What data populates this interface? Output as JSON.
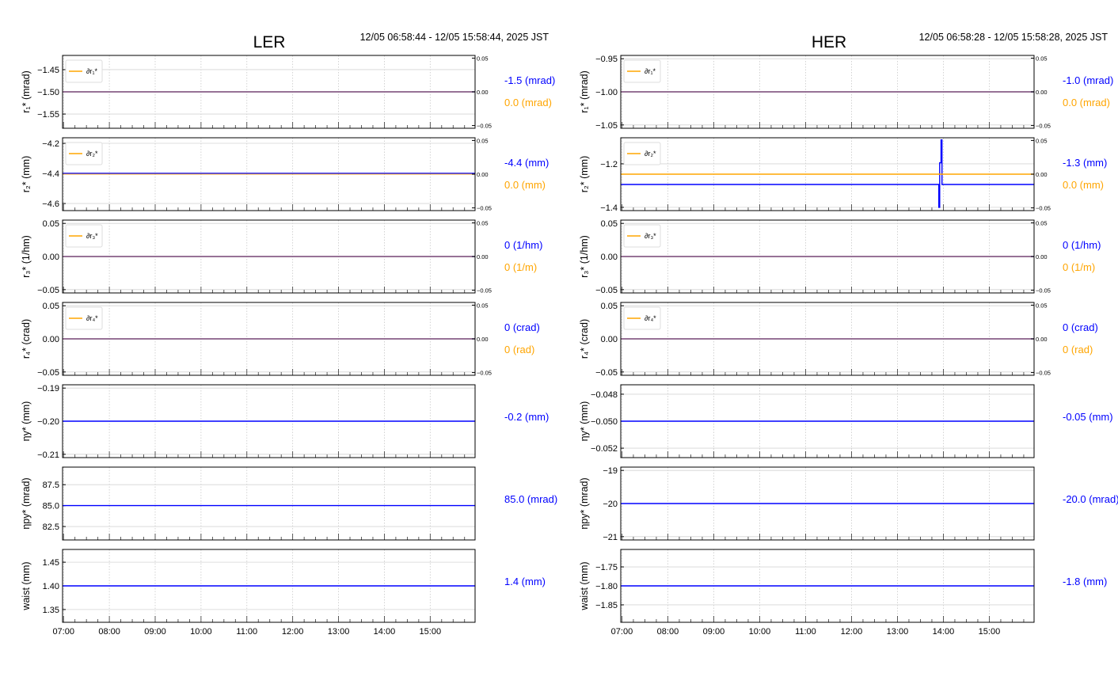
{
  "colors": {
    "blue": "#0000ff",
    "orange": "#ffa500",
    "grid": "#d0d0d0",
    "axis": "#000000"
  },
  "chart_data": [
    {
      "type": "line",
      "title": "LER",
      "time_range": "12/05 06:58:44 - 12/05 15:58:44, 2025 JST",
      "xlim": [
        6.979,
        15.979
      ],
      "x_ticks": [
        7,
        8,
        9,
        10,
        11,
        12,
        13,
        14,
        15
      ],
      "x_tick_labels": [
        "07:00",
        "08:00",
        "09:00",
        "10:00",
        "11:00",
        "12:00",
        "13:00",
        "14:00",
        "15:00"
      ],
      "panels": [
        {
          "ylabel": "r₁* (mrad)",
          "ylim": [
            -1.582,
            -1.418
          ],
          "yticks": [
            -1.45,
            -1.5,
            -1.55
          ],
          "ytick_labels": [
            "−1.45",
            "−1.50",
            "−1.55"
          ],
          "series": [
            {
              "name": "r1*",
              "color": "#0000ff",
              "axis": "left",
              "points": [
                [
                  6.979,
                  -1.5
                ],
                [
                  15.979,
                  -1.5
                ]
              ]
            },
            {
              "name": "∂r1*",
              "color": "#ffa500",
              "axis": "right",
              "points": [
                [
                  6.979,
                  0
                ],
                [
                  15.979,
                  0
                ]
              ]
            }
          ],
          "right": {
            "ylim": [
              -0.054,
              0.054
            ],
            "yticks": [
              0.05,
              0.0,
              -0.05
            ],
            "ytick_labels": [
              "0.05",
              "0.00",
              "−0.05"
            ]
          },
          "legend": "∂r₁*",
          "readouts": [
            {
              "text": "-1.5 (mrad)",
              "color": "#0000ff"
            },
            {
              "text": "0.0 (mrad)",
              "color": "#ffa500"
            }
          ]
        },
        {
          "ylabel": "r₂* (mm)",
          "ylim": [
            -4.647,
            -4.163
          ],
          "yticks": [
            -4.2,
            -4.4,
            -4.6
          ],
          "ytick_labels": [
            "−4.2",
            "−4.4",
            "−4.6"
          ],
          "series": [
            {
              "name": "r2*",
              "color": "#0000ff",
              "axis": "left",
              "points": [
                [
                  6.979,
                  -4.4
                ],
                [
                  15.979,
                  -4.4
                ]
              ]
            },
            {
              "name": "∂r2*",
              "color": "#ffa500",
              "axis": "right",
              "points": [
                [
                  6.979,
                  0
                ],
                [
                  15.979,
                  0
                ]
              ]
            }
          ],
          "right": {
            "ylim": [
              -0.054,
              0.054
            ],
            "yticks": [
              0.05,
              0.0,
              -0.05
            ],
            "ytick_labels": [
              "0.05",
              "0.00",
              "−0.05"
            ]
          },
          "legend": "∂r₂*",
          "readouts": [
            {
              "text": "-4.4 (mm)",
              "color": "#0000ff"
            },
            {
              "text": "0.0 (mm)",
              "color": "#ffa500"
            }
          ]
        },
        {
          "ylabel": "r₃* (1/hm)",
          "ylim": [
            -0.055,
            0.055
          ],
          "yticks": [
            0.05,
            0.0,
            -0.05
          ],
          "ytick_labels": [
            "0.05",
            "0.00",
            "−0.05"
          ],
          "series": [
            {
              "name": "r3*",
              "color": "#0000ff",
              "axis": "left",
              "points": [
                [
                  6.979,
                  0
                ],
                [
                  15.979,
                  0
                ]
              ]
            },
            {
              "name": "∂r3*",
              "color": "#ffa500",
              "axis": "right",
              "points": [
                [
                  6.979,
                  0
                ],
                [
                  15.979,
                  0
                ]
              ]
            }
          ],
          "right": {
            "ylim": [
              -0.054,
              0.054
            ],
            "yticks": [
              0.05,
              0.0,
              -0.05
            ],
            "ytick_labels": [
              "0.05",
              "0.00",
              "−0.05"
            ]
          },
          "legend": "∂r₃*",
          "readouts": [
            {
              "text": "0 (1/hm)",
              "color": "#0000ff"
            },
            {
              "text": "0 (1/m)",
              "color": "#ffa500"
            }
          ]
        },
        {
          "ylabel": "r₄* (crad)",
          "ylim": [
            -0.055,
            0.055
          ],
          "yticks": [
            0.05,
            0.0,
            -0.05
          ],
          "ytick_labels": [
            "0.05",
            "0.00",
            "−0.05"
          ],
          "series": [
            {
              "name": "r4*",
              "color": "#0000ff",
              "axis": "left",
              "points": [
                [
                  6.979,
                  0
                ],
                [
                  15.979,
                  0
                ]
              ]
            },
            {
              "name": "∂r4*",
              "color": "#ffa500",
              "axis": "right",
              "points": [
                [
                  6.979,
                  0
                ],
                [
                  15.979,
                  0
                ]
              ]
            }
          ],
          "right": {
            "ylim": [
              -0.054,
              0.054
            ],
            "yticks": [
              0.05,
              0.0,
              -0.05
            ],
            "ytick_labels": [
              "0.05",
              "0.00",
              "−0.05"
            ]
          },
          "legend": "∂r₄*",
          "readouts": [
            {
              "text": "0 (crad)",
              "color": "#0000ff"
            },
            {
              "text": "0 (rad)",
              "color": "#ffa500"
            }
          ]
        },
        {
          "ylabel": "ηy* (mm)",
          "ylim": [
            -0.211,
            -0.189
          ],
          "yticks": [
            -0.19,
            -0.2,
            -0.21
          ],
          "ytick_labels": [
            "−0.19",
            "−0.20",
            "−0.21"
          ],
          "series": [
            {
              "name": "eta_y*",
              "color": "#0000ff",
              "axis": "left",
              "points": [
                [
                  6.979,
                  -0.2
                ],
                [
                  15.979,
                  -0.2
                ]
              ]
            }
          ],
          "readouts": [
            {
              "text": "-0.2 (mm)",
              "color": "#0000ff"
            }
          ]
        },
        {
          "ylabel": "ηpy* (mrad)",
          "ylim": [
            80.9,
            89.6
          ],
          "yticks": [
            87.5,
            85.0,
            82.5
          ],
          "ytick_labels": [
            "87.5",
            "85.0",
            "82.5"
          ],
          "series": [
            {
              "name": "eta_py*",
              "color": "#0000ff",
              "axis": "left",
              "points": [
                [
                  6.979,
                  85.0
                ],
                [
                  15.979,
                  85.0
                ]
              ]
            }
          ],
          "readouts": [
            {
              "text": "85.0 (mrad)",
              "color": "#0000ff"
            }
          ]
        },
        {
          "ylabel": "waist (mm)",
          "ylim": [
            1.323,
            1.477
          ],
          "yticks": [
            1.45,
            1.4,
            1.35
          ],
          "ytick_labels": [
            "1.45",
            "1.40",
            "1.35"
          ],
          "series": [
            {
              "name": "waist",
              "color": "#0000ff",
              "axis": "left",
              "points": [
                [
                  6.979,
                  1.4
                ],
                [
                  15.979,
                  1.4
                ]
              ]
            }
          ],
          "readouts": [
            {
              "text": "1.4 (mm)",
              "color": "#0000ff"
            }
          ]
        }
      ]
    },
    {
      "type": "line",
      "title": "HER",
      "time_range": "12/05 06:58:28 - 12/05 15:58:28, 2025 JST",
      "xlim": [
        6.975,
        15.975
      ],
      "x_ticks": [
        7,
        8,
        9,
        10,
        11,
        12,
        13,
        14,
        15
      ],
      "x_tick_labels": [
        "07:00",
        "08:00",
        "09:00",
        "10:00",
        "11:00",
        "12:00",
        "13:00",
        "14:00",
        "15:00"
      ],
      "panels": [
        {
          "ylabel": "r₁* (mrad)",
          "ylim": [
            -1.055,
            -0.945
          ],
          "yticks": [
            -0.95,
            -1.0,
            -1.05
          ],
          "ytick_labels": [
            "−0.95",
            "−1.00",
            "−1.05"
          ],
          "series": [
            {
              "name": "r1*",
              "color": "#0000ff",
              "axis": "left",
              "points": [
                [
                  6.975,
                  -1.0
                ],
                [
                  15.975,
                  -1.0
                ]
              ]
            },
            {
              "name": "∂r1*",
              "color": "#ffa500",
              "axis": "right",
              "points": [
                [
                  6.975,
                  0
                ],
                [
                  15.975,
                  0
                ]
              ]
            }
          ],
          "right": {
            "ylim": [
              -0.054,
              0.054
            ],
            "yticks": [
              0.05,
              0.0,
              -0.05
            ],
            "ytick_labels": [
              "0.05",
              "0.00",
              "−0.05"
            ]
          },
          "legend": "∂r₁*",
          "readouts": [
            {
              "text": "-1.0 (mrad)",
              "color": "#0000ff"
            },
            {
              "text": "0.0 (mrad)",
              "color": "#ffa500"
            }
          ]
        },
        {
          "ylabel": "r₂* (mm)",
          "ylim": [
            -1.415,
            -1.08
          ],
          "yticks": [
            -1.2,
            -1.4
          ],
          "ytick_labels": [
            "−1.2",
            "−1.4"
          ],
          "series": [
            {
              "name": "r2*",
              "color": "#0000ff",
              "axis": "left",
              "points": [
                [
                  6.975,
                  -1.295
                ],
                [
                  13.9,
                  -1.295
                ],
                [
                  13.9,
                  -1.4
                ],
                [
                  13.92,
                  -1.4
                ],
                [
                  13.92,
                  -1.195
                ],
                [
                  13.95,
                  -1.195
                ],
                [
                  13.95,
                  -1.09
                ],
                [
                  13.97,
                  -1.09
                ],
                [
                  13.97,
                  -1.295
                ],
                [
                  15.975,
                  -1.295
                ]
              ]
            },
            {
              "name": "∂r2*",
              "color": "#ffa500",
              "axis": "right",
              "points": [
                [
                  6.975,
                  0
                ],
                [
                  15.975,
                  0
                ]
              ]
            }
          ],
          "right": {
            "ylim": [
              -0.054,
              0.054
            ],
            "yticks": [
              0.05,
              0.0,
              -0.05
            ],
            "ytick_labels": [
              "0.05",
              "0.00",
              "−0.05"
            ]
          },
          "legend": "∂r₂*",
          "readouts": [
            {
              "text": "-1.3 (mm)",
              "color": "#0000ff"
            },
            {
              "text": "0.0 (mm)",
              "color": "#ffa500"
            }
          ]
        },
        {
          "ylabel": "r₃* (1/hm)",
          "ylim": [
            -0.055,
            0.055
          ],
          "yticks": [
            0.05,
            0.0,
            -0.05
          ],
          "ytick_labels": [
            "0.05",
            "0.00",
            "−0.05"
          ],
          "series": [
            {
              "name": "r3*",
              "color": "#0000ff",
              "axis": "left",
              "points": [
                [
                  6.975,
                  0
                ],
                [
                  15.975,
                  0
                ]
              ]
            },
            {
              "name": "∂r3*",
              "color": "#ffa500",
              "axis": "right",
              "points": [
                [
                  6.975,
                  0
                ],
                [
                  15.975,
                  0
                ]
              ]
            }
          ],
          "right": {
            "ylim": [
              -0.054,
              0.054
            ],
            "yticks": [
              0.05,
              0.0,
              -0.05
            ],
            "ytick_labels": [
              "0.05",
              "0.00",
              "−0.05"
            ]
          },
          "legend": "∂r₃*",
          "readouts": [
            {
              "text": "0 (1/hm)",
              "color": "#0000ff"
            },
            {
              "text": "0 (1/m)",
              "color": "#ffa500"
            }
          ]
        },
        {
          "ylabel": "r₄* (crad)",
          "ylim": [
            -0.055,
            0.055
          ],
          "yticks": [
            0.05,
            0.0,
            -0.05
          ],
          "ytick_labels": [
            "0.05",
            "0.00",
            "−0.05"
          ],
          "series": [
            {
              "name": "r4*",
              "color": "#0000ff",
              "axis": "left",
              "points": [
                [
                  6.975,
                  0
                ],
                [
                  15.975,
                  0
                ]
              ]
            },
            {
              "name": "∂r4*",
              "color": "#ffa500",
              "axis": "right",
              "points": [
                [
                  6.975,
                  0
                ],
                [
                  15.975,
                  0
                ]
              ]
            }
          ],
          "right": {
            "ylim": [
              -0.054,
              0.054
            ],
            "yticks": [
              0.05,
              0.0,
              -0.05
            ],
            "ytick_labels": [
              "0.05",
              "0.00",
              "−0.05"
            ]
          },
          "legend": "∂r₄*",
          "readouts": [
            {
              "text": "0 (crad)",
              "color": "#0000ff"
            },
            {
              "text": "0 (rad)",
              "color": "#ffa500"
            }
          ]
        },
        {
          "ylabel": "ηy* (mm)",
          "ylim": [
            -0.0527,
            -0.0473
          ],
          "yticks": [
            -0.048,
            -0.05,
            -0.052
          ],
          "ytick_labels": [
            "−0.048",
            "−0.050",
            "−0.052"
          ],
          "series": [
            {
              "name": "eta_y*",
              "color": "#0000ff",
              "axis": "left",
              "points": [
                [
                  6.975,
                  -0.05
                ],
                [
                  15.975,
                  -0.05
                ]
              ]
            }
          ],
          "readouts": [
            {
              "text": "-0.05 (mm)",
              "color": "#0000ff"
            }
          ]
        },
        {
          "ylabel": "ηpy* (mrad)",
          "ylim": [
            -21.1,
            -18.9
          ],
          "yticks": [
            -19,
            -20,
            -21
          ],
          "ytick_labels": [
            "−19",
            "−20",
            "−21"
          ],
          "series": [
            {
              "name": "eta_py*",
              "color": "#0000ff",
              "axis": "left",
              "points": [
                [
                  6.975,
                  -20.0
                ],
                [
                  15.975,
                  -20.0
                ]
              ]
            }
          ],
          "readouts": [
            {
              "text": "-20.0 (mrad)",
              "color": "#0000ff"
            }
          ]
        },
        {
          "ylabel": "waist (mm)",
          "ylim": [
            -1.896,
            -1.704
          ],
          "yticks": [
            -1.75,
            -1.8,
            -1.85
          ],
          "ytick_labels": [
            "−1.75",
            "−1.80",
            "−1.85"
          ],
          "series": [
            {
              "name": "waist",
              "color": "#0000ff",
              "axis": "left",
              "points": [
                [
                  6.975,
                  -1.8
                ],
                [
                  15.975,
                  -1.8
                ]
              ]
            }
          ],
          "readouts": [
            {
              "text": "-1.8 (mm)",
              "color": "#0000ff"
            }
          ]
        }
      ]
    }
  ]
}
